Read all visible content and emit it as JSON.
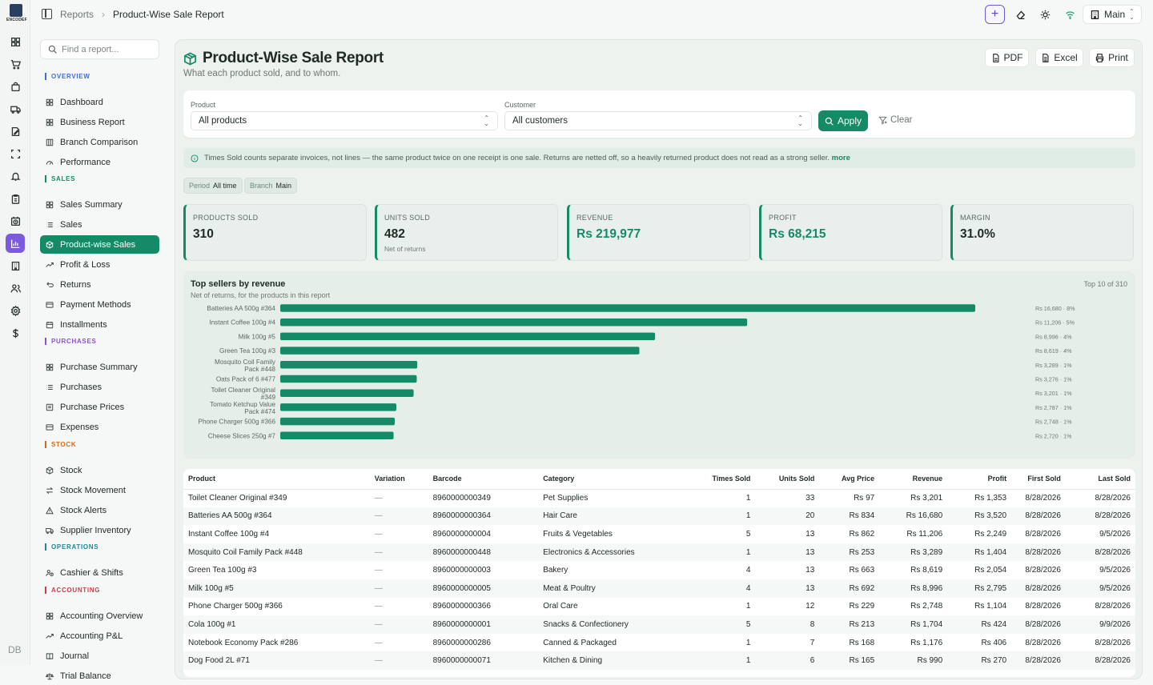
{
  "rail": {
    "logo_text": "ENCODEF",
    "icons": [
      "grid-icon",
      "cart-icon",
      "bag-icon",
      "truck-icon",
      "edit-icon",
      "frame-icon",
      "bell-icon",
      "clipboard-icon",
      "clock-icon",
      "bar-chart-icon",
      "building-icon",
      "users-icon",
      "settings-icon",
      "dollar-icon"
    ],
    "active_index": 9,
    "footer": "DB"
  },
  "topbar": {
    "breadcrumb_parent": "Reports",
    "breadcrumb_sep": "›",
    "breadcrumb_current": "Product-Wise Sale Report",
    "branch_label": "Main",
    "accent": "#6d5ad8"
  },
  "sidebar": {
    "search_placeholder": "Find a report...",
    "sections": [
      {
        "label": "OVERVIEW",
        "color": "#3b6fd8",
        "items": [
          {
            "label": "Dashboard",
            "icon": "grid-icon"
          },
          {
            "label": "Business Report",
            "icon": "grid-icon"
          },
          {
            "label": "Branch Comparison",
            "icon": "columns-icon"
          },
          {
            "label": "Performance",
            "icon": "gauge-icon"
          }
        ]
      },
      {
        "label": "SALES",
        "color": "#148a66",
        "items": [
          {
            "label": "Sales Summary",
            "icon": "grid-icon"
          },
          {
            "label": "Sales",
            "icon": "list-icon"
          },
          {
            "label": "Product-wise Sales",
            "icon": "box-icon",
            "active": true
          },
          {
            "label": "Profit & Loss",
            "icon": "trend-icon"
          },
          {
            "label": "Returns",
            "icon": "return-icon"
          },
          {
            "label": "Payment Methods",
            "icon": "card-icon"
          },
          {
            "label": "Installments",
            "icon": "calendar-icon"
          }
        ]
      },
      {
        "label": "PURCHASES",
        "color": "#8b4fd8",
        "items": [
          {
            "label": "Purchase Summary",
            "icon": "grid-icon"
          },
          {
            "label": "Purchases",
            "icon": "list-icon"
          },
          {
            "label": "Purchase Prices",
            "icon": "tag-icon"
          },
          {
            "label": "Expenses",
            "icon": "wallet-icon"
          }
        ]
      },
      {
        "label": "STOCK",
        "color": "#d2691e",
        "items": [
          {
            "label": "Stock",
            "icon": "box-icon"
          },
          {
            "label": "Stock Movement",
            "icon": "swap-icon"
          },
          {
            "label": "Stock Alerts",
            "icon": "alert-icon"
          },
          {
            "label": "Supplier Inventory",
            "icon": "truck-icon"
          }
        ]
      },
      {
        "label": "OPERATIONS",
        "color": "#1a8a9a",
        "items": [
          {
            "label": "Cashier & Shifts",
            "icon": "user-clock-icon"
          }
        ]
      },
      {
        "label": "ACCOUNTING",
        "color": "#d8384a",
        "items": [
          {
            "label": "Accounting Overview",
            "icon": "grid-icon"
          },
          {
            "label": "Accounting P&L",
            "icon": "trend-icon"
          },
          {
            "label": "Journal",
            "icon": "book-icon"
          },
          {
            "label": "Trial Balance",
            "icon": "scale-icon"
          }
        ]
      }
    ]
  },
  "page": {
    "title": "Product-Wise Sale Report",
    "subtitle": "What each product sold, and to whom.",
    "export_pdf": "PDF",
    "export_excel": "Excel",
    "export_print": "Print",
    "filters": {
      "product_label": "Product",
      "product_value": "All products",
      "customer_label": "Customer",
      "customer_value": "All customers",
      "apply_label": "Apply",
      "clear_label": "Clear"
    },
    "note_text": "Times Sold counts separate invoices, not lines — the same product twice on one receipt is one sale. Returns are netted off, so a heavily returned product does not read as a strong seller.",
    "note_more": "more",
    "chips": [
      {
        "key": "Period",
        "value": "All time"
      },
      {
        "key": "Branch",
        "value": "Main"
      }
    ],
    "kpis": [
      {
        "label": "PRODUCTS SOLD",
        "value": "310",
        "sub": "",
        "green": false
      },
      {
        "label": "UNITS SOLD",
        "value": "482",
        "sub": "Net of returns",
        "green": false
      },
      {
        "label": "REVENUE",
        "value": "Rs 219,977",
        "sub": "",
        "green": true
      },
      {
        "label": "PROFIT",
        "value": "Rs 68,215",
        "sub": "",
        "green": true
      },
      {
        "label": "MARGIN",
        "value": "31.0%",
        "sub": "",
        "green": false
      }
    ]
  },
  "chart_data": {
    "type": "bar",
    "orientation": "horizontal",
    "title": "Top sellers by revenue",
    "subtitle": "Net of returns, for the products in this report",
    "corner_note": "Top 10 of 310",
    "color": "#148a66",
    "categories": [
      "Batteries AA 500g #364",
      "Instant Coffee 100g #4",
      "Milk 100g #5",
      "Green Tea 100g #3",
      "Mosquito Coil Family Pack #448",
      "Oats Pack of 6 #477",
      "Toilet Cleaner Original #349",
      "Tomato Ketchup Value Pack #474",
      "Phone Charger 500g #366",
      "Cheese Slices 250g #7"
    ],
    "values": [
      16680,
      11206,
      8996,
      8619,
      3289,
      3276,
      3201,
      2787,
      2748,
      2720
    ],
    "value_labels": [
      "Rs 16,680 · 8%",
      "Rs 11,206 · 5%",
      "Rs 8,996 · 4%",
      "Rs 8,619 · 4%",
      "Rs 3,289 · 1%",
      "Rs 3,276 · 1%",
      "Rs 3,201 · 1%",
      "Rs 2,787 · 1%",
      "Rs 2,748 · 1%",
      "Rs 2,720 · 1%"
    ],
    "xlim": [
      0,
      16680
    ]
  },
  "table": {
    "columns": [
      "Product",
      "Variation",
      "Barcode",
      "Category",
      "Times Sold",
      "Units Sold",
      "Avg Price",
      "Revenue",
      "Profit",
      "First Sold",
      "Last Sold"
    ],
    "rows": [
      [
        "Toilet Cleaner Original #349",
        "—",
        "8960000000349",
        "Pet Supplies",
        "1",
        "33",
        "Rs 97",
        "Rs 3,201",
        "Rs 1,353",
        "8/28/2026",
        "8/28/2026"
      ],
      [
        "Batteries AA 500g #364",
        "—",
        "8960000000364",
        "Hair Care",
        "1",
        "20",
        "Rs 834",
        "Rs 16,680",
        "Rs 3,520",
        "8/28/2026",
        "8/28/2026"
      ],
      [
        "Instant Coffee 100g #4",
        "—",
        "8960000000004",
        "Fruits & Vegetables",
        "5",
        "13",
        "Rs 862",
        "Rs 11,206",
        "Rs 2,249",
        "8/28/2026",
        "9/5/2026"
      ],
      [
        "Mosquito Coil Family Pack #448",
        "—",
        "8960000000448",
        "Electronics & Accessories",
        "1",
        "13",
        "Rs 253",
        "Rs 3,289",
        "Rs 1,404",
        "8/28/2026",
        "8/28/2026"
      ],
      [
        "Green Tea 100g #3",
        "—",
        "8960000000003",
        "Bakery",
        "4",
        "13",
        "Rs 663",
        "Rs 8,619",
        "Rs 2,054",
        "8/28/2026",
        "9/5/2026"
      ],
      [
        "Milk 100g #5",
        "—",
        "8960000000005",
        "Meat & Poultry",
        "4",
        "13",
        "Rs 692",
        "Rs 8,996",
        "Rs 2,795",
        "8/28/2026",
        "9/5/2026"
      ],
      [
        "Phone Charger 500g #366",
        "—",
        "8960000000366",
        "Oral Care",
        "1",
        "12",
        "Rs 229",
        "Rs 2,748",
        "Rs 1,104",
        "8/28/2026",
        "8/28/2026"
      ],
      [
        "Cola 100g #1",
        "—",
        "8960000000001",
        "Snacks & Confectionery",
        "5",
        "8",
        "Rs 213",
        "Rs 1,704",
        "Rs 424",
        "8/28/2026",
        "9/9/2026"
      ],
      [
        "Notebook Economy Pack #286",
        "—",
        "8960000000286",
        "Canned & Packaged",
        "1",
        "7",
        "Rs 168",
        "Rs 1,176",
        "Rs 406",
        "8/28/2026",
        "8/28/2026"
      ],
      [
        "Dog Food 2L #71",
        "—",
        "8960000000071",
        "Kitchen & Dining",
        "1",
        "6",
        "Rs 165",
        "Rs 990",
        "Rs 270",
        "8/28/2026",
        "8/28/2026"
      ]
    ]
  }
}
